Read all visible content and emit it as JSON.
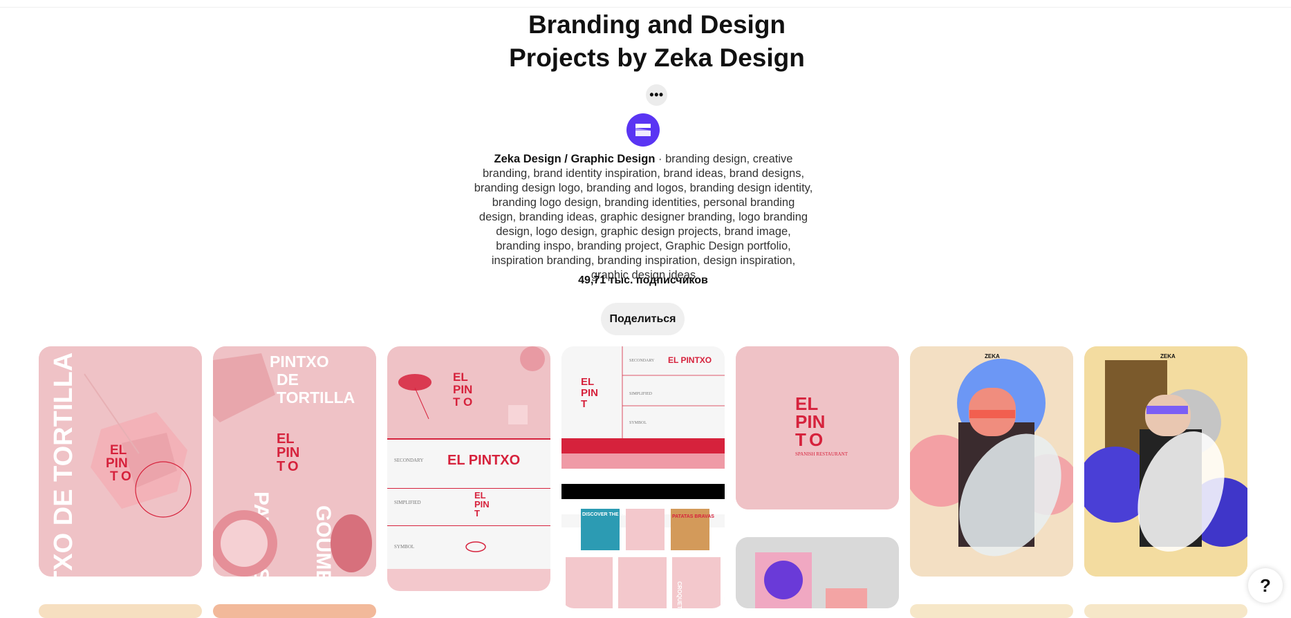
{
  "board": {
    "title_line1": "Branding and Design",
    "title_line2": "Projects by Zeka Design",
    "more_label": "•••",
    "owner": "Zeka Design / Graphic Design",
    "separator": " · ",
    "description": "branding design, creative branding, brand identity inspiration, brand ideas, brand designs, branding design logo, branding and logos, branding design identity, branding logo design, branding identities, personal branding design, branding ideas, graphic designer branding, logo branding design, logo design, graphic design projects, brand image, branding inspo, branding project, Graphic Design portfolio, inspiration branding, branding inspiration, design inspiration, graphic design ideas",
    "followers": "49,71 тыс. подписчиков",
    "share_label": "Поделиться"
  },
  "pins": {
    "p1": {
      "vertical": "PINTXO DE TORTILLA",
      "logo": [
        "EL",
        "PIN",
        "T",
        "O"
      ]
    },
    "p2": {
      "title": [
        "PINTXO",
        "DE",
        "TORTILLA"
      ],
      "logo": [
        "EL",
        "PIN",
        "T",
        "O"
      ],
      "side1": "PATATAS",
      "side2": "GOUMET"
    },
    "p3": {
      "logo_wide": "EL PINTXO",
      "labels": [
        "SECONDARY",
        "SIMPLIFIED",
        "SYMBOL"
      ]
    },
    "p4": {
      "labels": [
        "SECONDARY",
        "SIMPLIFIED",
        "SYMBOL"
      ],
      "logo_wide": "EL PINTXO",
      "discover": "DISCOVER THE TASTE OF",
      "patatas": "PATATAS BRAVAS",
      "croquetas": "CROQUETAS"
    },
    "p5": {
      "logo": [
        "EL",
        "PIN",
        "T",
        "O"
      ],
      "subtitle": "SPANISH RESTAURANT"
    },
    "p6": {
      "brand": "ZEKA"
    },
    "p7": {
      "brand": "ZEKA"
    }
  },
  "colors": {
    "accent": "#5a35f3",
    "brand_red": "#d6223c",
    "pink": "#efc2c6"
  },
  "help_label": "?"
}
